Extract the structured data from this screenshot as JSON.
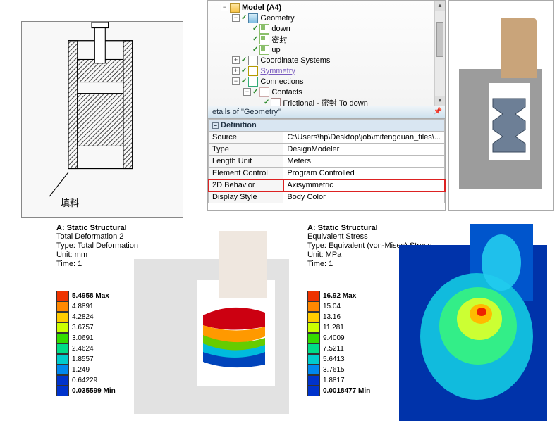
{
  "sketch": {
    "label": "填料"
  },
  "tree": {
    "model": "Model (A4)",
    "geometry": "Geometry",
    "bodies": [
      "down",
      "密封",
      "up"
    ],
    "coord": "Coordinate Systems",
    "symmetry": "Symmetry",
    "connections": "Connections",
    "contacts": "Contacts",
    "frictional": "Frictional - 密封 To down"
  },
  "details": {
    "header": "etails of \"Geometry\"",
    "group": "Definition",
    "rows": {
      "source_k": "Source",
      "source_v": "C:\\Users\\hp\\Desktop\\job\\mifengquan_files\\...",
      "type_k": "Type",
      "type_v": "DesignModeler",
      "length_k": "Length Unit",
      "length_v": "Meters",
      "elem_k": "Element Control",
      "elem_v": "Program Controlled",
      "b2d_k": "2D Behavior",
      "b2d_v": "Axisymmetric",
      "disp_k": "Display Style",
      "disp_v": "Body Color"
    }
  },
  "result_left": {
    "title": "A: Static Structural",
    "name": "Total Deformation 2",
    "type": "Type: Total Deformation",
    "unit": "Unit: mm",
    "time": "Time: 1",
    "legend": [
      "5.4958 Max",
      "4.8891",
      "4.2824",
      "3.6757",
      "3.0691",
      "2.4624",
      "1.8557",
      "1.249",
      "0.64229",
      "0.035599 Min"
    ]
  },
  "result_right": {
    "title": "A: Static Structural",
    "name": "Equivalent Stress",
    "type": "Type: Equivalent (von-Mises) Stress",
    "unit": "Unit: MPa",
    "time": "Time: 1",
    "legend": [
      "16.92 Max",
      "15.04",
      "13.16",
      "11.281",
      "9.4009",
      "7.5211",
      "5.6413",
      "3.7615",
      "1.8817",
      "0.0018477 Min"
    ]
  },
  "chart_data": [
    {
      "type": "table",
      "title": "Details of \"Geometry\" — Definition",
      "categories": [
        "Source",
        "Type",
        "Length Unit",
        "Element Control",
        "2D Behavior",
        "Display Style"
      ],
      "values": [
        "C:\\Users\\hp\\Desktop\\job\\mifengquan_files\\...",
        "DesignModeler",
        "Meters",
        "Program Controlled",
        "Axisymmetric",
        "Body Color"
      ]
    },
    {
      "type": "heatmap",
      "title": "A: Static Structural — Total Deformation 2",
      "ylabel": "Total Deformation (mm)",
      "values": [
        5.4958,
        4.8891,
        4.2824,
        3.6757,
        3.0691,
        2.4624,
        1.8557,
        1.249,
        0.64229,
        0.035599
      ],
      "ylim": [
        0.035599,
        5.4958
      ]
    },
    {
      "type": "heatmap",
      "title": "A: Static Structural — Equivalent (von-Mises) Stress",
      "ylabel": "Stress (MPa)",
      "values": [
        16.92,
        15.04,
        13.16,
        11.281,
        9.4009,
        7.5211,
        5.6413,
        3.7615,
        1.8817,
        0.0018477
      ],
      "ylim": [
        0.0018477,
        16.92
      ]
    }
  ]
}
